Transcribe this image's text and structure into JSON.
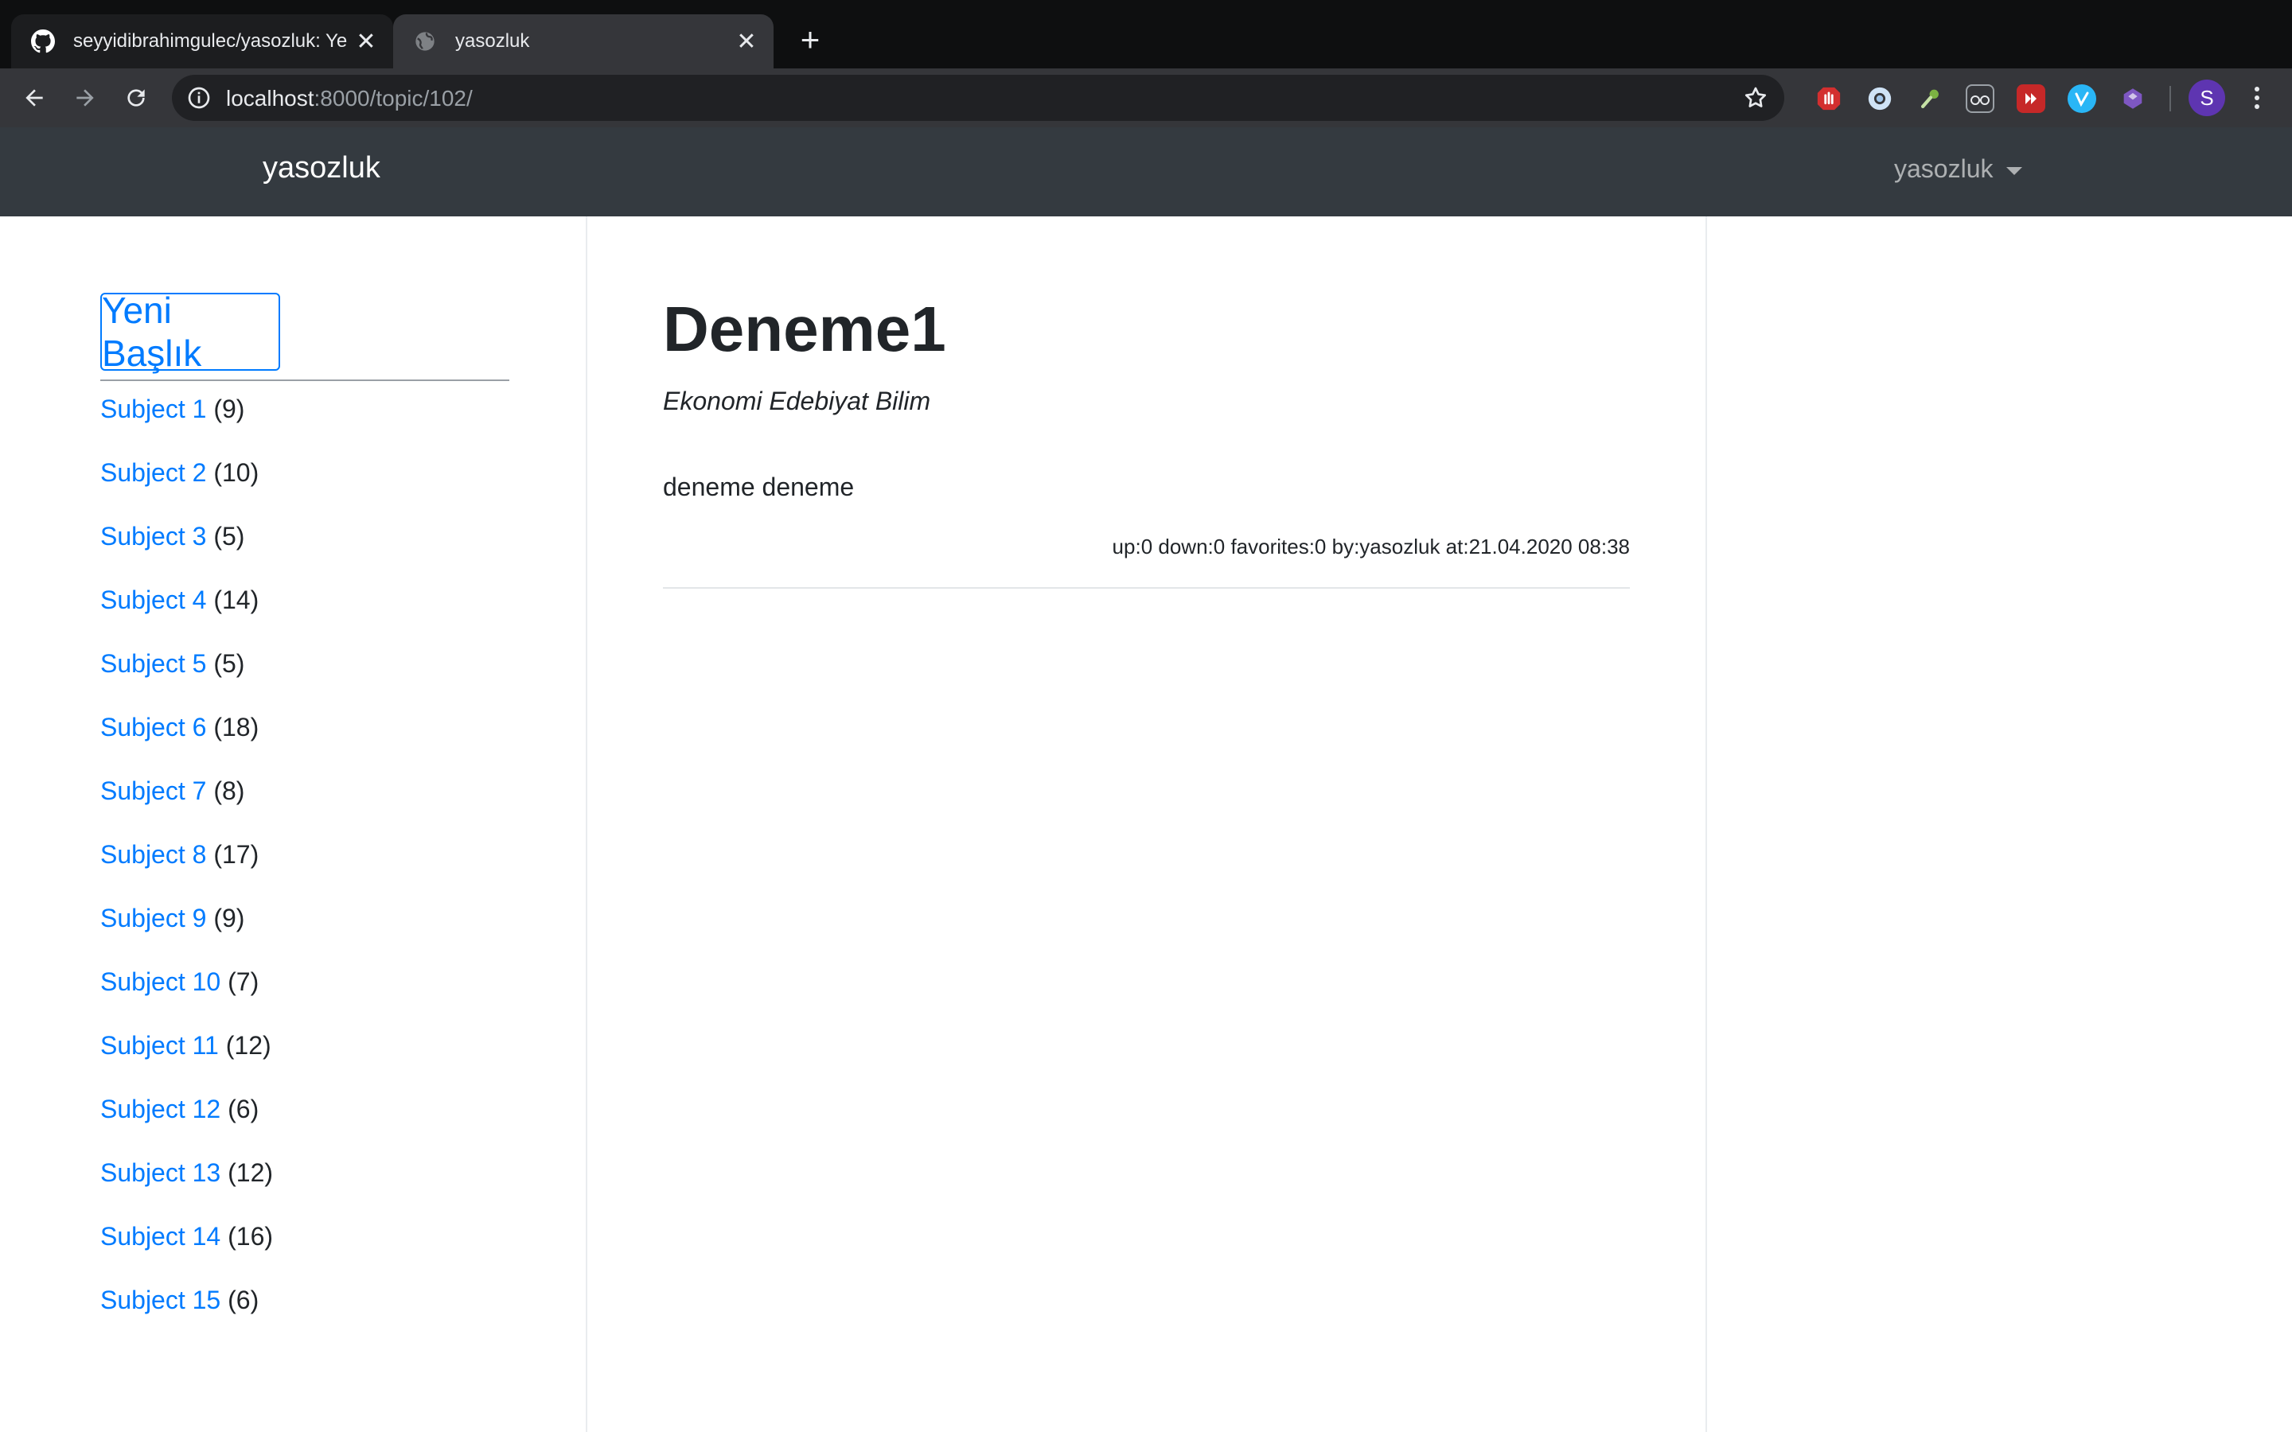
{
  "browser": {
    "tabs": [
      {
        "title": "seyyidibrahimgulec/yasozluk: Ye",
        "icon": "github-icon",
        "active": false
      },
      {
        "title": "yasozluk",
        "icon": "globe-icon",
        "active": true
      }
    ],
    "address": {
      "host": "localhost",
      "path": ":8000/topic/102/"
    },
    "profile_initial": "S",
    "extensions": [
      "adblock-icon",
      "ring-extension-icon",
      "key-extension-icon",
      "glasses-extension-icon",
      "red-box-extension-icon",
      "v-extension-icon",
      "purple-cube-extension-icon"
    ]
  },
  "navbar": {
    "brand": "yasozluk",
    "user": "yasozluk"
  },
  "sidebar": {
    "new_topic_button": "Yeni Başlık",
    "subjects": [
      {
        "label": "Subject 1",
        "count": "(9)"
      },
      {
        "label": "Subject 2",
        "count": "(10)"
      },
      {
        "label": "Subject 3",
        "count": "(5)"
      },
      {
        "label": "Subject 4",
        "count": "(14)"
      },
      {
        "label": "Subject 5",
        "count": "(5)"
      },
      {
        "label": "Subject 6",
        "count": "(18)"
      },
      {
        "label": "Subject 7",
        "count": "(8)"
      },
      {
        "label": "Subject 8",
        "count": "(17)"
      },
      {
        "label": "Subject 9",
        "count": "(9)"
      },
      {
        "label": "Subject 10",
        "count": "(7)"
      },
      {
        "label": "Subject 11",
        "count": "(12)"
      },
      {
        "label": "Subject 12",
        "count": "(6)"
      },
      {
        "label": "Subject 13",
        "count": "(12)"
      },
      {
        "label": "Subject 14",
        "count": "(16)"
      },
      {
        "label": "Subject 15",
        "count": "(6)"
      }
    ]
  },
  "topic": {
    "title": "Deneme1",
    "categories": "Ekonomi Edebiyat Bilim",
    "entries": [
      {
        "text": "deneme deneme",
        "meta": "up:0 down:0 favorites:0 by:yasozluk at:21.04.2020 08:38"
      }
    ]
  },
  "colors": {
    "link": "#007bff",
    "navbar": "#343a40",
    "text": "#212529"
  }
}
